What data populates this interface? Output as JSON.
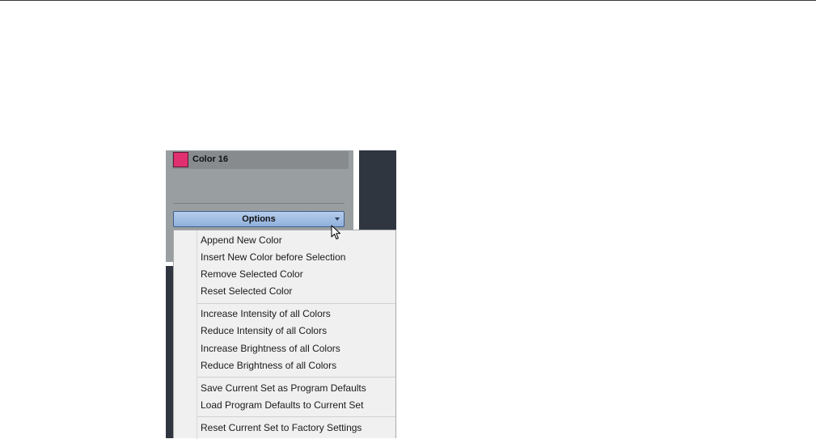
{
  "panel": {
    "color_name": "Color 16",
    "swatch_color": "#e0306f",
    "options_label": "Options"
  },
  "menu": {
    "items": [
      "Append New Color",
      "Insert New Color before Selection",
      "Remove Selected Color",
      "Reset Selected Color",
      "Increase Intensity of all Colors",
      "Reduce Intensity of all Colors",
      "Increase Brightness of all Colors",
      "Reduce Brightness of all Colors",
      "Save Current Set as Program Defaults",
      "Load Program Defaults to Current Set",
      "Reset Current Set to Factory Settings"
    ]
  },
  "icons": {
    "dropdown": "chevron-down-icon",
    "pointer": "mouse-pointer-icon"
  },
  "colors": {
    "accent": "#8fb0dc",
    "panel_bg": "#999ea1",
    "dark_bg": "#2f3640",
    "menu_bg": "#f0f0f0"
  }
}
